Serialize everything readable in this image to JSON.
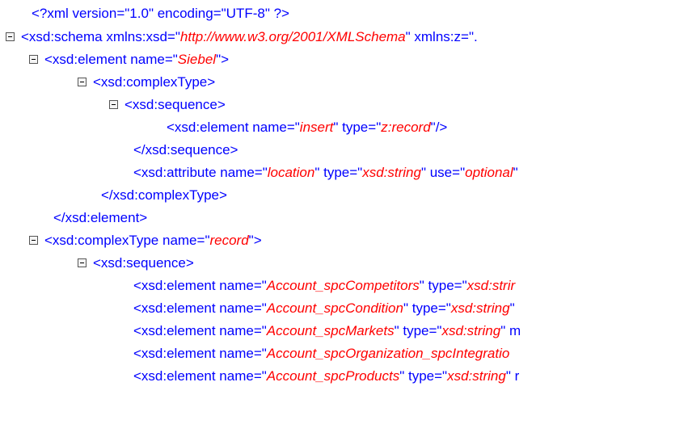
{
  "lines": [
    {
      "name": "xml-declaration",
      "text": "<?xml version=\"1.0\" encoding=\"UTF-8\" ?>"
    },
    {
      "name": "schema-open",
      "pre": "<xsd:schema xmlns:xsd=\"",
      "val": "http://www.w3.org/2001/XMLSchema",
      "post": "\" xmlns:z=\"."
    },
    {
      "name": "element-siebel-open",
      "pre": "<xsd:element name=\"",
      "val": "Siebel",
      "post": "\">"
    },
    {
      "name": "complextype-open",
      "text": "<xsd:complexType>"
    },
    {
      "name": "sequence-open",
      "text": "<xsd:sequence>"
    },
    {
      "name": "element-insert",
      "pre": "<xsd:element name=\"",
      "val": "insert",
      "mid": "\" type=\"",
      "val2": "z:record",
      "post": "\"/>"
    },
    {
      "name": "sequence-close",
      "text": "</xsd:sequence>"
    },
    {
      "name": "attribute-location",
      "pre": "<xsd:attribute name=\"",
      "val": "location",
      "mid": "\" type=\"",
      "val2": "xsd:string",
      "mid2": "\" use=\"",
      "val3": "optional",
      "post": "\""
    },
    {
      "name": "complextype-close",
      "text": "</xsd:complexType>"
    },
    {
      "name": "element-close",
      "text": "</xsd:element>"
    },
    {
      "name": "complextype-record-open",
      "pre": "<xsd:complexType name=\"",
      "val": "record",
      "post": "\">"
    },
    {
      "name": "sequence-open-2",
      "text": "<xsd:sequence>"
    },
    {
      "name": "element-competitors",
      "pre": "<xsd:element name=\"",
      "val": "Account_spcCompetitors",
      "mid": "\" type=\"",
      "val2": "xsd:strir",
      "post": ""
    },
    {
      "name": "element-condition",
      "pre": "<xsd:element name=\"",
      "val": "Account_spcCondition",
      "mid": "\" type=\"",
      "val2": "xsd:string",
      "post": "\""
    },
    {
      "name": "element-markets",
      "pre": "<xsd:element name=\"",
      "val": "Account_spcMarkets",
      "mid": "\" type=\"",
      "val2": "xsd:string",
      "post": "\" m"
    },
    {
      "name": "element-organization",
      "pre": "<xsd:element name=\"",
      "val": "Account_spcOrganization_spcIntegratio",
      "post": ""
    },
    {
      "name": "element-products",
      "pre": "<xsd:element name=\"",
      "val": "Account_spcProducts",
      "mid": "\" type=\"",
      "val2": "xsd:string",
      "post": "\" r"
    }
  ]
}
